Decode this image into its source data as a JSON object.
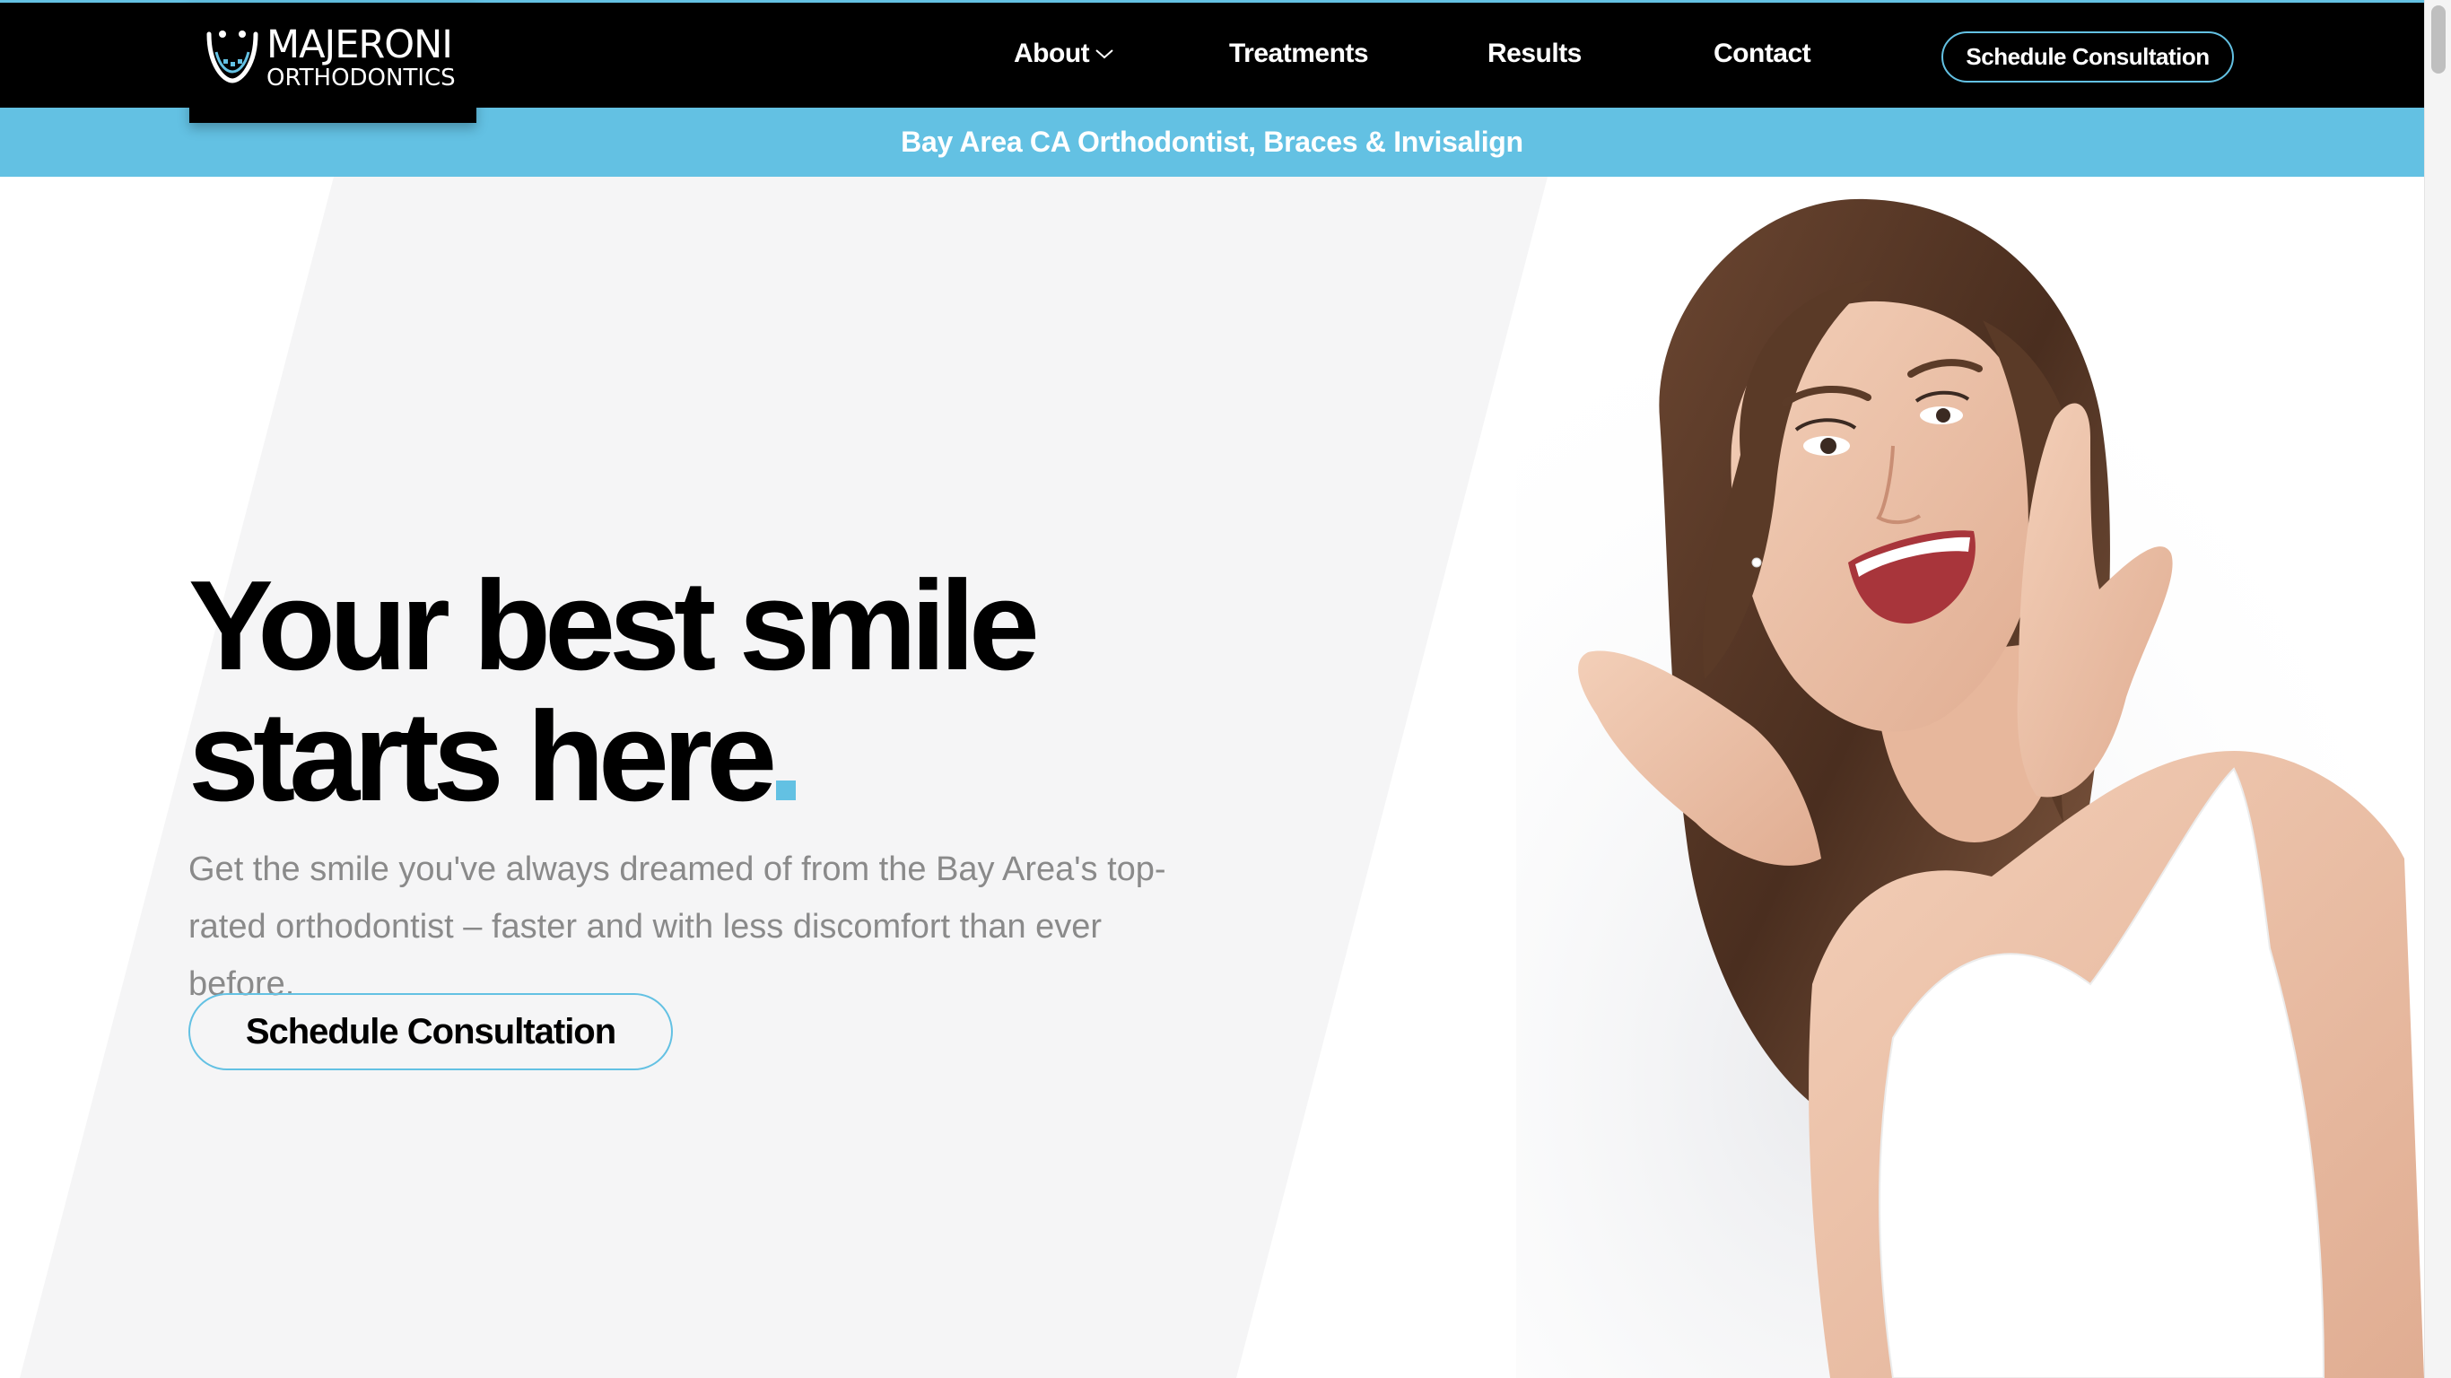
{
  "brand": {
    "name_line1": "MAJERONI",
    "name_line2": "ORTHODONTICS",
    "logo_icon": "smile-braces-icon"
  },
  "nav": {
    "items": [
      {
        "label": "About",
        "has_dropdown": true
      },
      {
        "label": "Treatments"
      },
      {
        "label": "Results"
      },
      {
        "label": "Contact"
      }
    ],
    "cta_label": "Schedule Consultation"
  },
  "tagline": "Bay Area CA Orthodontist, Braces & Invisalign",
  "hero": {
    "headline_line1": "Your best smile",
    "headline_line2": "starts here",
    "subtext": "Get the smile you've always dreamed of from the Bay Area's top-rated orthodontist – faster and with less discomfort than ever before.",
    "cta_label": "Schedule Consultation",
    "image": "smiling-woman-photo"
  },
  "colors": {
    "accent": "#63c1e3",
    "nav_bg": "#000000",
    "slant_panel": "#f5f5f6",
    "body_text": "#000000",
    "muted_text": "#8a8a8a"
  }
}
